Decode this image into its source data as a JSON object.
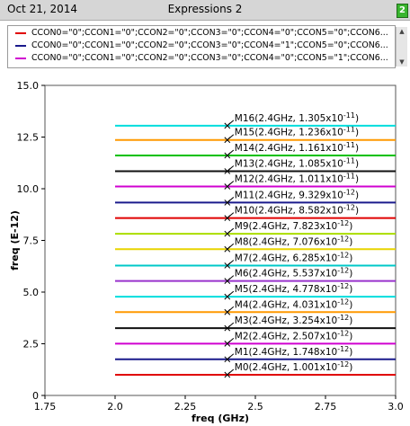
{
  "window": {
    "date": "Oct 21, 2014",
    "title": "Expressions 2",
    "corner_button": "2"
  },
  "legend": {
    "entries": [
      {
        "label": "CCON0=\"0\";CCON1=\"0\";CCON2=\"0\";CCON3=\"0\";CCON4=\"0\";CCON5=\"0\";CCON6...",
        "color": "#e00000"
      },
      {
        "label": "CCON0=\"0\";CCON1=\"0\";CCON2=\"0\";CCON3=\"0\";CCON4=\"1\";CCON5=\"0\";CCON6...",
        "color": "#1a1a8c"
      },
      {
        "label": "CCON0=\"0\";CCON1=\"0\";CCON2=\"0\";CCON3=\"0\";CCON4=\"0\";CCON5=\"1\";CCON6...",
        "color": "#d000d0"
      }
    ]
  },
  "chart_data": {
    "type": "line",
    "xlabel": "freq (GHz)",
    "ylabel": "freq (E-12)",
    "xlim": [
      1.75,
      3.0
    ],
    "ylim": [
      0,
      15.0
    ],
    "xticks": [
      "1.75",
      "2.0",
      "2.25",
      "2.5",
      "2.75",
      "3.0"
    ],
    "yticks": [
      "0",
      "2.5",
      "5.0",
      "7.5",
      "10.0",
      "12.5",
      "15.0"
    ],
    "x_range": [
      2.0,
      3.0
    ],
    "marker_x": 2.4,
    "series": [
      {
        "marker": "M0(2.4GHz, 1.001x10",
        "exp": "-12",
        "value": 1.001,
        "color": "#e00000"
      },
      {
        "marker": "M1(2.4GHz, 1.748x10",
        "exp": "-12",
        "value": 1.748,
        "color": "#1a1a8c"
      },
      {
        "marker": "M2(2.4GHz, 2.507x10",
        "exp": "-12",
        "value": 2.507,
        "color": "#d000d0"
      },
      {
        "marker": "M3(2.4GHz, 3.254x10",
        "exp": "-12",
        "value": 3.254,
        "color": "#111111"
      },
      {
        "marker": "M4(2.4GHz, 4.031x10",
        "exp": "-12",
        "value": 4.031,
        "color": "#ff9900"
      },
      {
        "marker": "M5(2.4GHz, 4.778x10",
        "exp": "-12",
        "value": 4.778,
        "color": "#00dddd"
      },
      {
        "marker": "M6(2.4GHz, 5.537x10",
        "exp": "-12",
        "value": 5.537,
        "color": "#9933cc"
      },
      {
        "marker": "M7(2.4GHz, 6.285x10",
        "exp": "-12",
        "value": 6.285,
        "color": "#00c8c8"
      },
      {
        "marker": "M8(2.4GHz, 7.076x10",
        "exp": "-12",
        "value": 7.076,
        "color": "#e8d400"
      },
      {
        "marker": "M9(2.4GHz, 7.823x10",
        "exp": "-12",
        "value": 7.823,
        "color": "#aadd00"
      },
      {
        "marker": "M10(2.4GHz, 8.582x10",
        "exp": "-12",
        "value": 8.582,
        "color": "#e00000"
      },
      {
        "marker": "M11(2.4GHz, 9.329x10",
        "exp": "-12",
        "value": 9.329,
        "color": "#1a1a8c"
      },
      {
        "marker": "M12(2.4GHz, 1.011x10",
        "exp": "-11",
        "value": 10.11,
        "color": "#d000d0"
      },
      {
        "marker": "M13(2.4GHz, 1.085x10",
        "exp": "-11",
        "value": 10.85,
        "color": "#111111"
      },
      {
        "marker": "M14(2.4GHz, 1.161x10",
        "exp": "-11",
        "value": 11.61,
        "color": "#00c000"
      },
      {
        "marker": "M15(2.4GHz, 1.236x10",
        "exp": "-11",
        "value": 12.36,
        "color": "#ff9900"
      },
      {
        "marker": "M16(2.4GHz, 1.305x10",
        "exp": "-11",
        "value": 13.05,
        "color": "#00dddd"
      }
    ]
  }
}
